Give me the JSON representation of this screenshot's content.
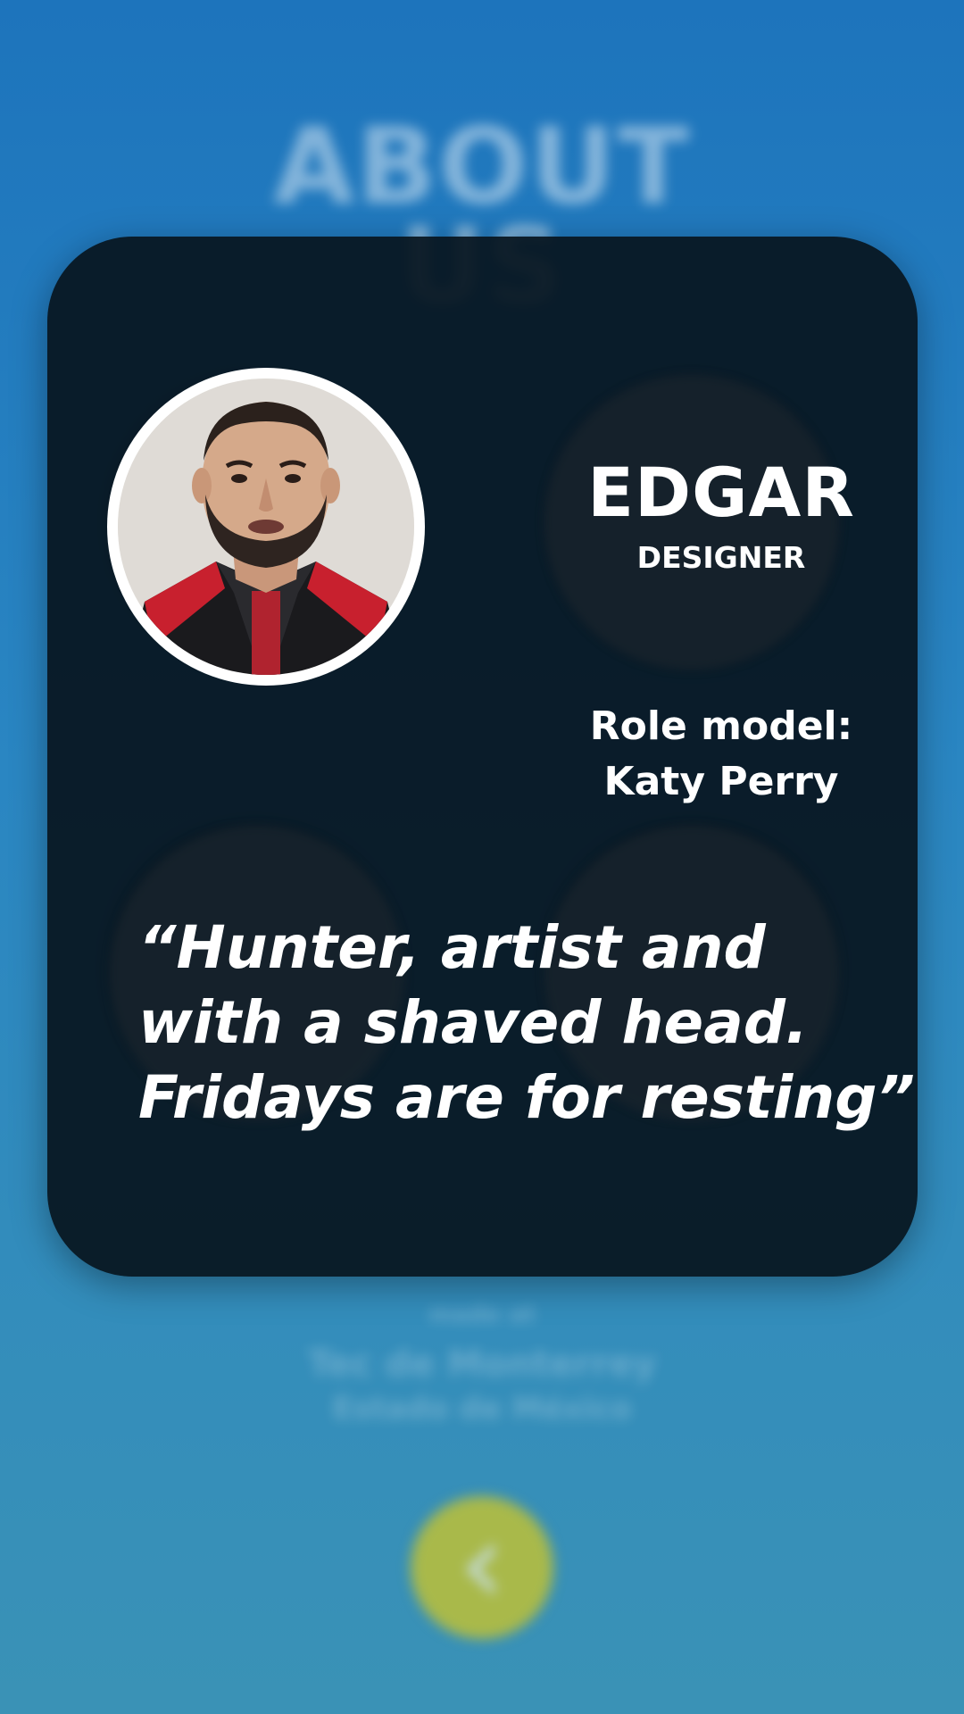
{
  "background": {
    "title": [
      "ABOUT",
      "US"
    ],
    "footer": {
      "made_at": "made at",
      "school": "Tec de Monterrey",
      "campus": "Estado de México"
    },
    "back_icon": "chevron-left-icon",
    "accent_color": "#a9b94a"
  },
  "profile": {
    "name": "EDGAR",
    "role": "DESIGNER",
    "role_model_label": "Role model:",
    "role_model": "Katy Perry",
    "quote_lines": [
      "“Hunter, artist and",
      "with a shaved head.",
      "Fridays are for resting”"
    ]
  }
}
